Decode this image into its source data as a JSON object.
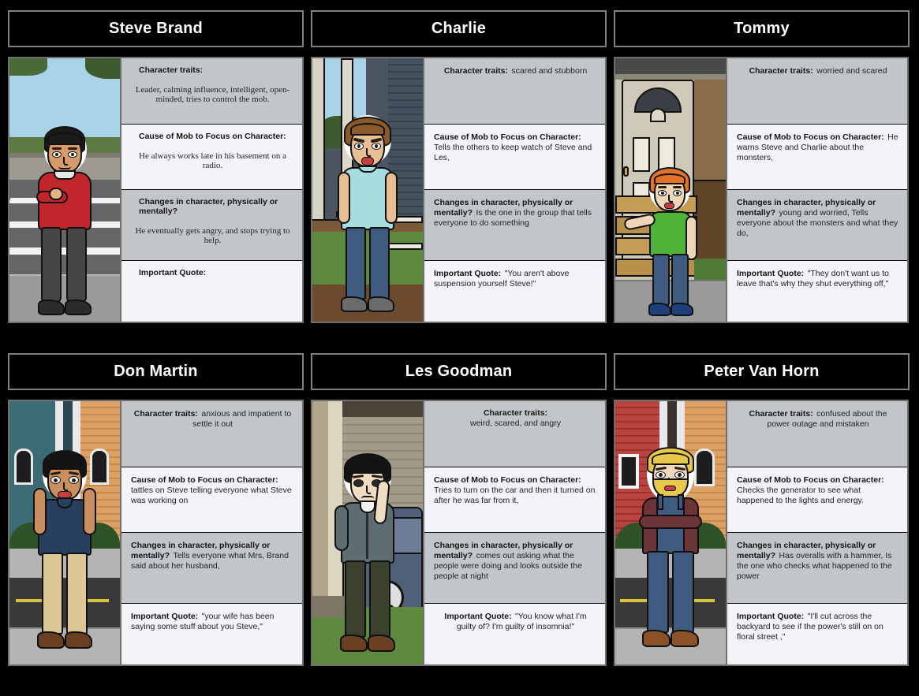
{
  "board": {
    "background_color": "#000000",
    "title_plate_color": "#000000",
    "title_text_color": "#ffffff",
    "cell_shade_color": "#c3c6c9",
    "cell_light_color": "#f3f4f8",
    "border_color": "#6f6f6f"
  },
  "labels": {
    "traits": "Character traits:",
    "cause": "Cause of Mob to Focus on Character:",
    "changes": "Changes in character, physically or mentally?",
    "quote": "Important Quote:"
  },
  "panels": [
    {
      "title": "Steve Brand",
      "style": "stacked",
      "traits": "Leader, calming influence, intelligent, open-minded, tries to control the mob.",
      "cause": "He always works late in his basement on a radio.",
      "changes": "He eventually gets angry, and stops trying to help.",
      "quote": "",
      "scene": {
        "name": "street-crosswalk-daytime",
        "sky": "#a9d4e8",
        "ground": "#9a9a9a",
        "road": "#6d6d6d",
        "foliage": "#4a6b38",
        "wall": "#9d9a92"
      },
      "character": {
        "name": "steve-brand-avatar",
        "skin": "#d79a6a",
        "hair": "#1b1b1b",
        "shirt": "#c0262b",
        "pants": "#454545",
        "shoes": "#2b2b2b"
      }
    },
    {
      "title": "Charlie",
      "style": "inline",
      "traits": "scared  and stubborn",
      "cause": "Tells the others to keep watch of Steve and Les,",
      "changes": "Is the one in the group that tells everyone to do something",
      "quote": "\"You aren't above suspension yourself Steve!\"",
      "scene": {
        "name": "porch-front-house",
        "sky": "#a9d4e8",
        "ground": "#5e8a3f",
        "road": "#7b5a3a",
        "foliage": "#3d5a2e",
        "wall": "#4a5560"
      },
      "character": {
        "name": "charlie-avatar",
        "skin": "#e8bf94",
        "hair": "#8a5a2b",
        "shirt": "#a6dde0",
        "pants": "#3f5b80",
        "shoes": "#6b6b6b"
      }
    },
    {
      "title": "Tommy",
      "style": "inline",
      "traits": "worried and scared",
      "cause": "He warns Steve and Charlie about the monsters,",
      "changes": "young and worried, Tells everyone about the monsters and what they do,",
      "quote": "\"They don't want us to leave that's why they shut everything off,\"",
      "scene": {
        "name": "front-door-steps",
        "sky": "#c9c3b2",
        "ground": "#9a9a9a",
        "road": "#b89a62",
        "foliage": "#4f7a34",
        "wall": "#8a6b4a"
      },
      "character": {
        "name": "tommy-avatar",
        "skin": "#f0d6b8",
        "hair": "#e2722a",
        "shirt": "#4fb337",
        "pants": "#3f5b80",
        "shoes": "#1f3f7a"
      }
    },
    {
      "title": "Don Martin",
      "style": "inline",
      "traits": "anxious and impatient to settle it out",
      "cause": "tattles on Steve telling everyone what Steve was working on",
      "changes": "Tells everyone what Mrs, Brand said about her husband,",
      "quote": "\"your wife has been saying some stuff about you Steve,\"",
      "scene": {
        "name": "suburban-street-houses",
        "sky": "#3c6b73",
        "ground": "#b4b4b4",
        "road": "#3a3a3a",
        "foliage": "#2f5228",
        "wall": "#d99a5a"
      },
      "character": {
        "name": "don-martin-avatar",
        "skin": "#c98f5f",
        "hair": "#141414",
        "shirt": "#28405e",
        "pants": "#ddc795",
        "shoes": "#6b3f22"
      }
    },
    {
      "title": "Les Goodman",
      "style": "centered-mixed",
      "traits": "weird, scared, and angry",
      "cause": "Tries to turn on the car and then it turned on after he was far from it,",
      "changes": "comes out asking what the people were doing and looks outside the people at night",
      "quote": "\"You know what I'm guilty of? I'm guilty of insomnia!\"",
      "scene": {
        "name": "garage-with-car",
        "sky": "#6a6a60",
        "ground": "#5e8a3f",
        "road": "#51607a",
        "foliage": "#3d5a2e",
        "wall": "#8a7f66"
      },
      "character": {
        "name": "les-goodman-avatar",
        "skin": "#efdcc2",
        "hair": "#141414",
        "shirt": "#5d6d72",
        "pants": "#3b412c",
        "shoes": "#6b3f22"
      }
    },
    {
      "title": "Peter Van Horn",
      "style": "inline",
      "traits": "confused about the power outage and mistaken",
      "cause": "Checks the generator to see what happened to the lights and energy.",
      "changes": "Has overalls with a hammer, Is the one who checks what happened to the power",
      "quote": "\"I'll cut across the backyard to see if the power's still on on floral street ,\"",
      "scene": {
        "name": "red-house-street",
        "sky": "#b03a35",
        "ground": "#b4b4b4",
        "road": "#3a3a3a",
        "foliage": "#2f5228",
        "wall": "#d99a5a"
      },
      "character": {
        "name": "peter-van-horn-avatar",
        "skin": "#f0d8ba",
        "hair": "#e8c84a",
        "shirt": "#6b3538",
        "pants": "#3f5b80",
        "shoes": "#8a5226"
      }
    }
  ]
}
